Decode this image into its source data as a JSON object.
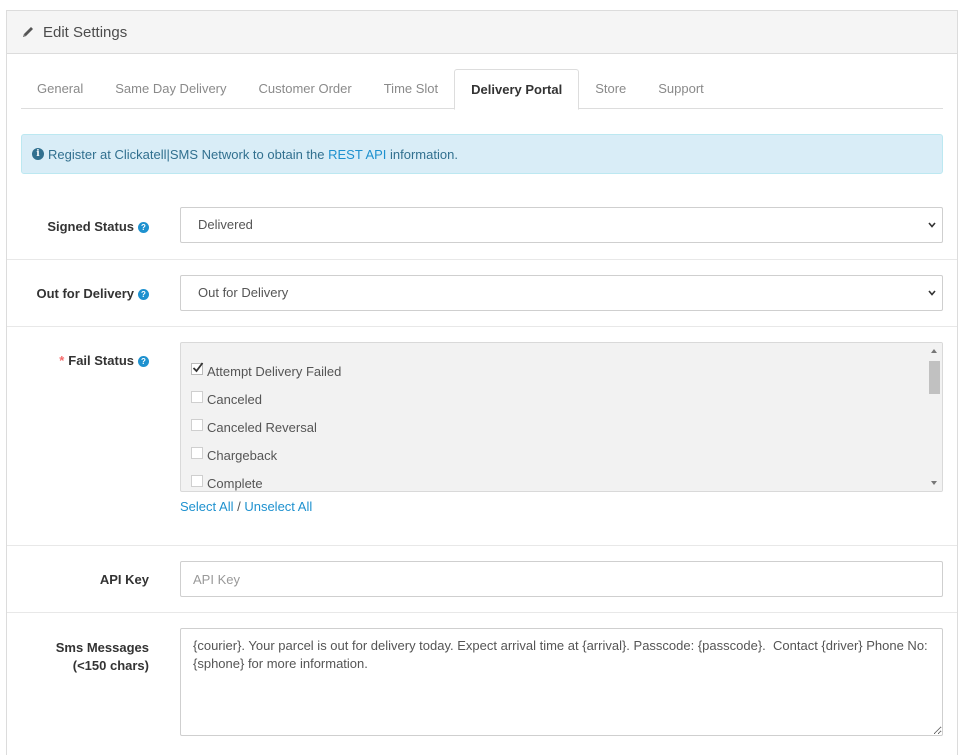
{
  "panel": {
    "title": "Edit Settings"
  },
  "tabs": [
    {
      "label": "General",
      "active": false
    },
    {
      "label": "Same Day Delivery",
      "active": false
    },
    {
      "label": "Customer Order",
      "active": false
    },
    {
      "label": "Time Slot",
      "active": false
    },
    {
      "label": "Delivery Portal",
      "active": true
    },
    {
      "label": "Store",
      "active": false
    },
    {
      "label": "Support",
      "active": false
    }
  ],
  "alert": {
    "prefix": "Register at Clickatell|SMS Network to obtain the ",
    "link": "REST API",
    "suffix": " information."
  },
  "signed_status": {
    "label": "Signed Status",
    "value": "Delivered"
  },
  "out_for_delivery": {
    "label": "Out for Delivery",
    "value": "Out for Delivery"
  },
  "fail_status": {
    "required_mark": "*",
    "label": "Fail Status",
    "options": [
      {
        "label": "Attempt Delivery Failed",
        "checked": true
      },
      {
        "label": "Canceled",
        "checked": false
      },
      {
        "label": "Canceled Reversal",
        "checked": false
      },
      {
        "label": "Chargeback",
        "checked": false
      },
      {
        "label": "Complete",
        "checked": false
      }
    ],
    "select_all": "Select All",
    "separator": " / ",
    "unselect_all": "Unselect All"
  },
  "api_key": {
    "label": "API Key",
    "placeholder": "API Key",
    "value": ""
  },
  "sms_messages": {
    "label_line1": "Sms Messages",
    "label_line2": "(<150 chars)",
    "value": "{courier}. Your parcel is out for delivery today. Expect arrival time at {arrival}. Passcode: {passcode}.  Contact {driver} Phone No: {sphone} for more information."
  },
  "colors": {
    "link": "#1e91cf",
    "alert_bg": "#d9edf7",
    "alert_text": "#31708f",
    "required": "#f56b6b"
  },
  "icons": {
    "heading": "pencil-icon",
    "alert": "info-circle-icon",
    "help": "question-circle-icon",
    "select": "chevron-down-icon"
  }
}
